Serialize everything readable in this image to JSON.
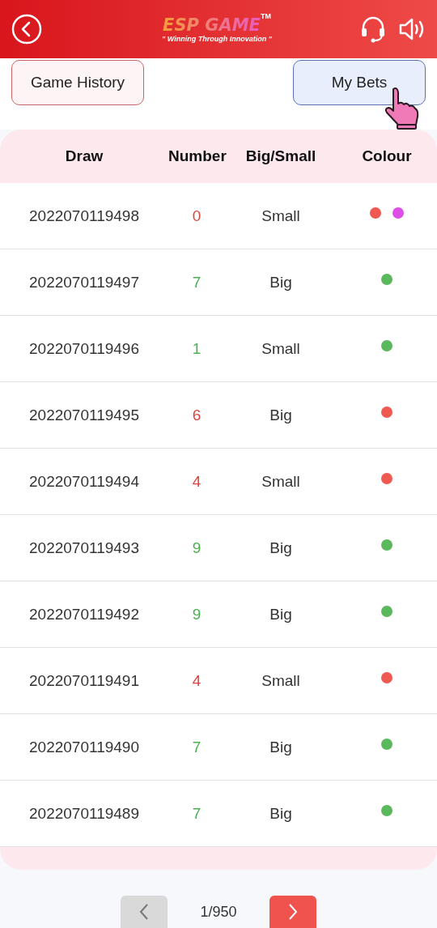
{
  "header": {
    "logo": "ESP GAME",
    "trademark": "TM",
    "tagline": "\" Winning Through Innovation \""
  },
  "tabs": [
    {
      "label": "Game History",
      "selected": false
    },
    {
      "label": "My Bets",
      "selected": true
    }
  ],
  "table": {
    "columns": [
      "Draw",
      "Number",
      "Big/Small",
      "Colour"
    ],
    "rows": [
      {
        "draw": "2022070119498",
        "number": "0",
        "color": "#d9463e",
        "size": "Small",
        "dots": [
          {
            "color": "#ee5a52"
          },
          {
            "color": "#dc4ee6"
          }
        ]
      },
      {
        "draw": "2022070119497",
        "number": "7",
        "color": "#4caf50",
        "size": "Big",
        "dots": [
          {
            "color": "#5cb85c"
          }
        ]
      },
      {
        "draw": "2022070119496",
        "number": "1",
        "color": "#4caf50",
        "size": "Small",
        "dots": [
          {
            "color": "#5cb85c"
          }
        ]
      },
      {
        "draw": "2022070119495",
        "number": "6",
        "color": "#d9463e",
        "size": "Big",
        "dots": [
          {
            "color": "#ee5a52"
          }
        ]
      },
      {
        "draw": "2022070119494",
        "number": "4",
        "color": "#d9463e",
        "size": "Small",
        "dots": [
          {
            "color": "#ee5a52"
          }
        ]
      },
      {
        "draw": "2022070119493",
        "number": "9",
        "color": "#4caf50",
        "size": "Big",
        "dots": [
          {
            "color": "#5cb85c"
          }
        ]
      },
      {
        "draw": "2022070119492",
        "number": "9",
        "color": "#4caf50",
        "size": "Big",
        "dots": [
          {
            "color": "#5cb85c"
          }
        ]
      },
      {
        "draw": "2022070119491",
        "number": "4",
        "color": "#d9463e",
        "size": "Small",
        "dots": [
          {
            "color": "#ee5a52"
          }
        ]
      },
      {
        "draw": "2022070119490",
        "number": "7",
        "color": "#4caf50",
        "size": "Big",
        "dots": [
          {
            "color": "#5cb85c"
          }
        ]
      },
      {
        "draw": "2022070119489",
        "number": "7",
        "color": "#4caf50",
        "size": "Big",
        "dots": [
          {
            "color": "#5cb85c"
          }
        ]
      }
    ]
  },
  "pager": {
    "page": "1/950",
    "prev_disabled": true,
    "next_disabled": false
  }
}
